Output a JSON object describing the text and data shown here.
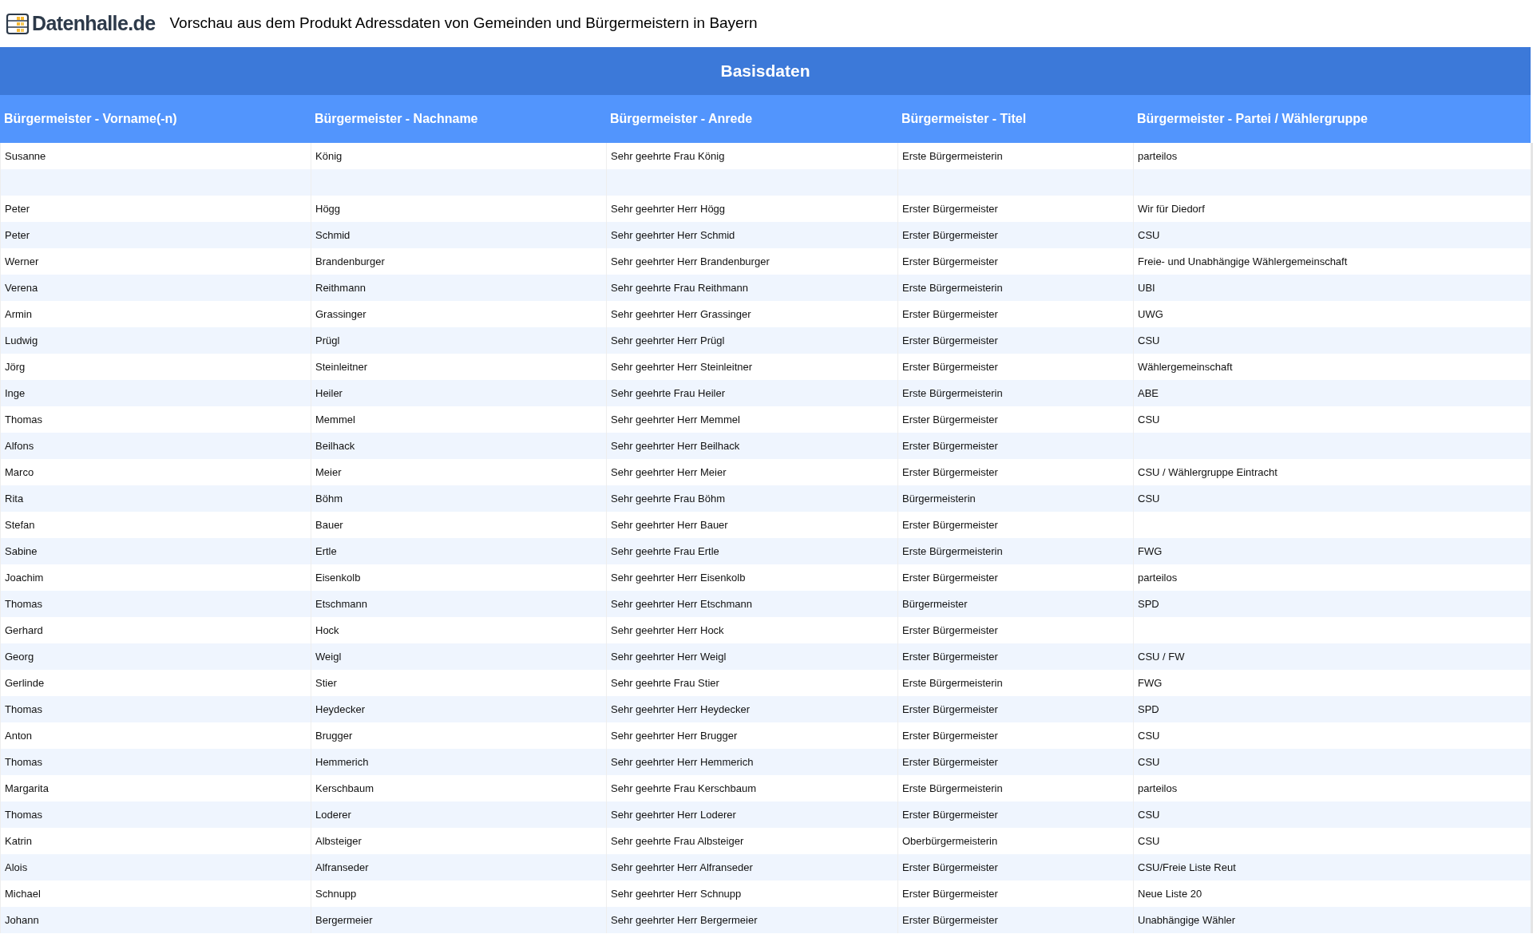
{
  "header": {
    "logo_text": "Datenhalle.de",
    "title": "Vorschau aus dem Produkt Adressdaten von Gemeinden und Bürgermeistern in Bayern"
  },
  "table": {
    "group_title": "Basisdaten",
    "columns": [
      "Bürgermeister - Vorname(-n)",
      "Bürgermeister - Nachname",
      "Bürgermeister - Anrede",
      "Bürgermeister - Titel",
      "Bürgermeister - Partei / Wählergruppe"
    ],
    "rows": [
      {
        "vorname": "Susanne",
        "nachname": "König",
        "anrede": "Sehr geehrte Frau König",
        "titel": "Erste Bürgermeisterin",
        "partei": "parteilos"
      },
      {},
      {
        "vorname": "Peter",
        "nachname": "Högg",
        "anrede": "Sehr geehrter Herr Högg",
        "titel": "Erster Bürgermeister",
        "partei": "Wir für Diedorf"
      },
      {
        "vorname": "Peter",
        "nachname": "Schmid",
        "anrede": "Sehr geehrter Herr Schmid",
        "titel": "Erster Bürgermeister",
        "partei": "CSU"
      },
      {
        "vorname": "Werner",
        "nachname": "Brandenburger",
        "anrede": "Sehr geehrter Herr Brandenburger",
        "titel": "Erster Bürgermeister",
        "partei": "Freie- und Unabhängige Wählergemeinschaft"
      },
      {
        "vorname": "Verena",
        "nachname": "Reithmann",
        "anrede": "Sehr geehrte Frau Reithmann",
        "titel": "Erste Bürgermeisterin",
        "partei": "UBI"
      },
      {
        "vorname": "Armin",
        "nachname": "Grassinger",
        "anrede": "Sehr geehrter Herr Grassinger",
        "titel": "Erster Bürgermeister",
        "partei": "UWG"
      },
      {
        "vorname": "Ludwig",
        "nachname": "Prügl",
        "anrede": "Sehr geehrter Herr Prügl",
        "titel": "Erster Bürgermeister",
        "partei": "CSU"
      },
      {
        "vorname": "Jörg",
        "nachname": "Steinleitner",
        "anrede": "Sehr geehrter Herr Steinleitner",
        "titel": "Erster Bürgermeister",
        "partei": "Wählergemeinschaft"
      },
      {
        "vorname": "Inge",
        "nachname": "Heiler",
        "anrede": "Sehr geehrte Frau Heiler",
        "titel": "Erste Bürgermeisterin",
        "partei": "ABE"
      },
      {
        "vorname": "Thomas",
        "nachname": "Memmel",
        "anrede": "Sehr geehrter Herr Memmel",
        "titel": "Erster Bürgermeister",
        "partei": "CSU"
      },
      {
        "vorname": "Alfons",
        "nachname": "Beilhack",
        "anrede": "Sehr geehrter Herr Beilhack",
        "titel": "Erster Bürgermeister"
      },
      {
        "vorname": "Marco",
        "nachname": "Meier",
        "anrede": "Sehr geehrter Herr Meier",
        "titel": "Erster Bürgermeister",
        "partei": "CSU / Wählergruppe Eintracht"
      },
      {
        "vorname": "Rita",
        "nachname": "Böhm",
        "anrede": "Sehr geehrte Frau Böhm",
        "titel": "Bürgermeisterin",
        "partei": "CSU"
      },
      {
        "vorname": "Stefan",
        "nachname": "Bauer",
        "anrede": "Sehr geehrter Herr Bauer",
        "titel": "Erster Bürgermeister"
      },
      {
        "vorname": "Sabine",
        "nachname": "Ertle",
        "anrede": "Sehr geehrte Frau Ertle",
        "titel": "Erste Bürgermeisterin",
        "partei": "FWG"
      },
      {
        "vorname": "Joachim",
        "nachname": "Eisenkolb",
        "anrede": "Sehr geehrter Herr Eisenkolb",
        "titel": "Erster Bürgermeister",
        "partei": "parteilos"
      },
      {
        "vorname": "Thomas",
        "nachname": "Etschmann",
        "anrede": "Sehr geehrter Herr Etschmann",
        "titel": "Bürgermeister",
        "partei": "SPD"
      },
      {
        "vorname": "Gerhard",
        "nachname": "Hock",
        "anrede": "Sehr geehrter Herr Hock",
        "titel": "Erster Bürgermeister"
      },
      {
        "vorname": "Georg",
        "nachname": "Weigl",
        "anrede": "Sehr geehrter Herr Weigl",
        "titel": "Erster Bürgermeister",
        "partei": "CSU / FW"
      },
      {
        "vorname": "Gerlinde",
        "nachname": "Stier",
        "anrede": "Sehr geehrte Frau Stier",
        "titel": "Erste Bürgermeisterin",
        "partei": "FWG"
      },
      {
        "vorname": "Thomas",
        "nachname": "Heydecker",
        "anrede": "Sehr geehrter Herr Heydecker",
        "titel": "Erster Bürgermeister",
        "partei": "SPD"
      },
      {
        "vorname": "Anton",
        "nachname": "Brugger",
        "anrede": "Sehr geehrter Herr Brugger",
        "titel": "Erster Bürgermeister",
        "partei": "CSU"
      },
      {
        "vorname": "Thomas",
        "nachname": "Hemmerich",
        "anrede": "Sehr geehrter Herr Hemmerich",
        "titel": "Erster Bürgermeister",
        "partei": "CSU"
      },
      {
        "vorname": "Margarita",
        "nachname": "Kerschbaum",
        "anrede": "Sehr geehrte Frau Kerschbaum",
        "titel": "Erste Bürgermeisterin",
        "partei": "parteilos"
      },
      {
        "vorname": "Thomas",
        "nachname": "Loderer",
        "anrede": "Sehr geehrter Herr Loderer",
        "titel": "Erster Bürgermeister",
        "partei": "CSU"
      },
      {
        "vorname": "Katrin",
        "nachname": "Albsteiger",
        "anrede": "Sehr geehrte Frau Albsteiger",
        "titel": "Oberbürgermeisterin",
        "partei": "CSU"
      },
      {
        "vorname": "Alois",
        "nachname": "Alfranseder",
        "anrede": "Sehr geehrter Herr Alfranseder",
        "titel": "Erster Bürgermeister",
        "partei": "CSU/Freie Liste Reut"
      },
      {
        "vorname": "Michael",
        "nachname": "Schnupp",
        "anrede": "Sehr geehrter Herr Schnupp",
        "titel": "Erster Bürgermeister",
        "partei": "Neue Liste 20"
      },
      {
        "vorname": "Johann",
        "nachname": "Bergermeier",
        "anrede": "Sehr geehrter Herr Bergermeier",
        "titel": "Erster Bürgermeister",
        "partei": "Unabhängige Wähler"
      }
    ]
  }
}
